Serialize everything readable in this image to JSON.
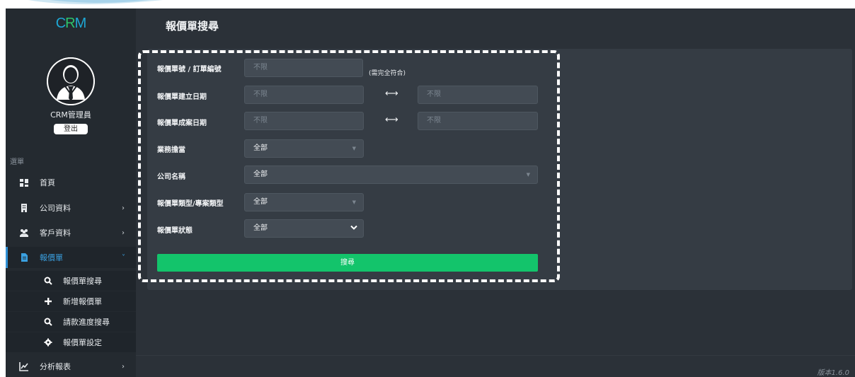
{
  "app": {
    "logo": {
      "c": "C",
      "r": "R",
      "m": "M"
    },
    "version": "版本1.6.0"
  },
  "user": {
    "name": "CRM管理員",
    "logout_label": "登出"
  },
  "sidebar": {
    "caption": "選單",
    "items": [
      {
        "label": "首頁",
        "icon": "dashboard-icon"
      },
      {
        "label": "公司資料",
        "icon": "building-icon",
        "chevron": "›"
      },
      {
        "label": "客戶資料",
        "icon": "users-icon",
        "chevron": "›"
      },
      {
        "label": "報價單",
        "icon": "file-icon",
        "chevron": "˅",
        "active": true
      },
      {
        "label": "分析報表",
        "icon": "chart-icon",
        "chevron": "›"
      }
    ],
    "sub_items": [
      {
        "label": "報價單搜尋",
        "icon": "search-icon"
      },
      {
        "label": "新增報價單",
        "icon": "plus-icon"
      },
      {
        "label": "請款進度搜尋",
        "icon": "search-icon"
      },
      {
        "label": "報價單設定",
        "icon": "gear-icon"
      }
    ]
  },
  "page": {
    "title": "報價單搜尋"
  },
  "form": {
    "quote_no": {
      "label": "報價單號 / 訂單編號",
      "placeholder": "不限",
      "hint": "(需完全符合)"
    },
    "created_date": {
      "label": "報價單建立日期",
      "from_placeholder": "不限",
      "to_placeholder": "不限",
      "arrow": "⟷"
    },
    "closed_date": {
      "label": "報價單成案日期",
      "from_placeholder": "不限",
      "to_placeholder": "不限",
      "arrow": "⟷"
    },
    "sales": {
      "label": "業務擔當",
      "value": "全部"
    },
    "company": {
      "label": "公司名稱",
      "value": "全部"
    },
    "quote_type": {
      "label": "報價單類型/專案類型",
      "value": "全部"
    },
    "status": {
      "label": "報價單狀態",
      "value": "全部"
    },
    "search_label": "搜尋"
  },
  "colors": {
    "accent_green": "#13c46b",
    "active_blue": "#3aa0e0",
    "sidebar_bg": "#242a30",
    "main_bg": "#2b3138"
  }
}
